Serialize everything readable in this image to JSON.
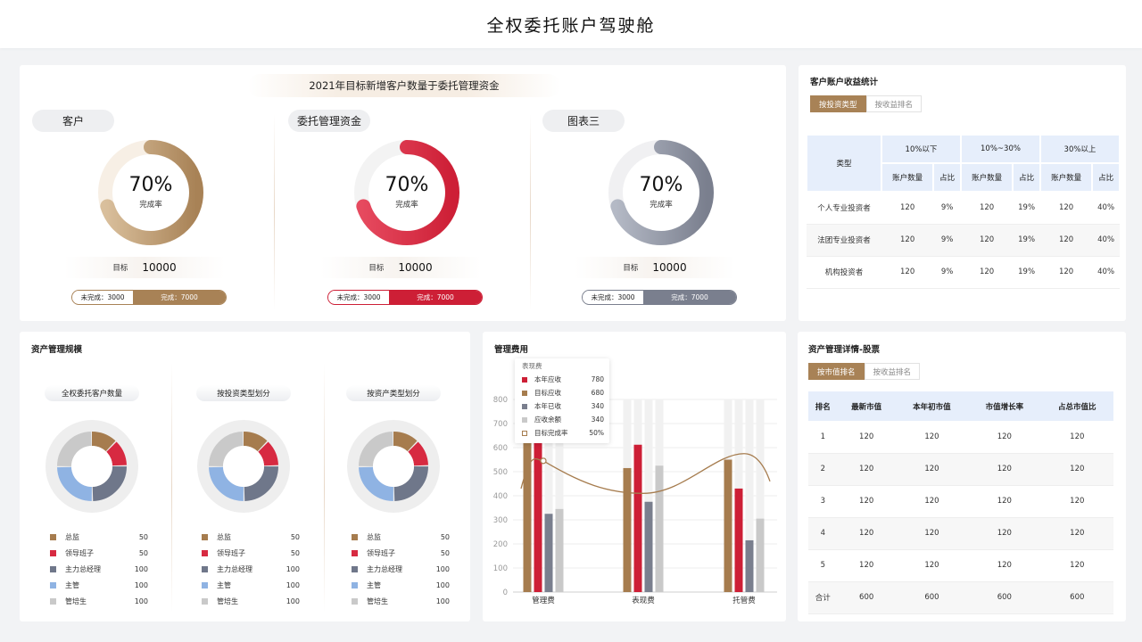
{
  "page_title": "全权委托账户驾驶舱",
  "goal": {
    "banner": "2021年目标新增客户数量于委托管理资金",
    "blocks": [
      {
        "label": "客户",
        "percent": "70%",
        "rate_label": "完成率",
        "target_label": "目标",
        "target_value": "10000",
        "undone": "未完成：3000",
        "done": "完成：7000",
        "fraction": 0.7,
        "color": "#a88256",
        "color_light": "#d9bf9c"
      },
      {
        "label": "委托管理资金",
        "percent": "70%",
        "rate_label": "完成率",
        "target_label": "目标",
        "target_value": "10000",
        "undone": "未完成：3000",
        "done": "完成：7000",
        "fraction": 0.7,
        "color": "#cd1f36",
        "color_light": "#e64a5f"
      },
      {
        "label": "图表三",
        "percent": "70%",
        "rate_label": "完成率",
        "target_label": "目标",
        "target_value": "10000",
        "undone": "未完成：3000",
        "done": "完成：7000",
        "fraction": 0.7,
        "color": "#7a7f8e",
        "color_light": "#b4b9c5"
      }
    ]
  },
  "income": {
    "title": "客户账户收益统计",
    "tabs": [
      "按投资类型",
      "按收益排名"
    ],
    "col_type": "类型",
    "groups": [
      "10%以下",
      "10%~30%",
      "30%以上"
    ],
    "sub_cols": [
      "账户数量",
      "占比"
    ],
    "rows": [
      [
        "个人专业投资者",
        "120",
        "9%",
        "120",
        "19%",
        "120",
        "40%"
      ],
      [
        "法团专业投资者",
        "120",
        "9%",
        "120",
        "19%",
        "120",
        "40%"
      ],
      [
        "机构投资者",
        "120",
        "9%",
        "120",
        "19%",
        "120",
        "40%"
      ]
    ]
  },
  "scale": {
    "title": "资产管理规模",
    "groups": [
      {
        "title": "全权委托客户数量"
      },
      {
        "title": "按投资类型划分"
      },
      {
        "title": "按资产类型划分"
      }
    ],
    "legend": [
      {
        "name": "总监",
        "value": "50",
        "color": "#a67c4e"
      },
      {
        "name": "领导班子",
        "value": "50",
        "color": "#d72a41"
      },
      {
        "name": "主力总经理",
        "value": "100",
        "color": "#6f778a"
      },
      {
        "name": "主管",
        "value": "100",
        "color": "#8fb3e3"
      },
      {
        "name": "管培生",
        "value": "100",
        "color": "#c9c9c9"
      }
    ]
  },
  "fees": {
    "title": "管理费用",
    "tooltip_title": "表现费",
    "tooltip": [
      {
        "name": "本年应收",
        "value": "780",
        "color": "#cd1f36",
        "hollow": false
      },
      {
        "name": "目标应收",
        "value": "680",
        "color": "#a67c4e",
        "hollow": false
      },
      {
        "name": "本年已收",
        "value": "340",
        "color": "#7a7f8e",
        "hollow": false
      },
      {
        "name": "应收余额",
        "value": "340",
        "color": "#c9c9c9",
        "hollow": false
      },
      {
        "name": "目标完成率",
        "value": "50%",
        "color": "#a67c4e",
        "hollow": true
      }
    ]
  },
  "chart_data": {
    "type": "bar",
    "categories": [
      "管理费",
      "表现费",
      "托管费"
    ],
    "ylim": [
      0,
      800
    ],
    "yticks": [
      "0",
      "100",
      "200",
      "300",
      "400",
      "500",
      "600",
      "700",
      "800"
    ],
    "series": [
      {
        "values": [
          680,
          515,
          550
        ],
        "color": "#a67c4e"
      },
      {
        "values": [
          780,
          612,
          430
        ],
        "color": "#cd1f36"
      },
      {
        "values": [
          325,
          375,
          215
        ],
        "color": "#7a7f8e"
      },
      {
        "values": [
          345,
          525,
          305
        ],
        "color": "#c9c9c9"
      }
    ],
    "line": {
      "values": [
        545,
        410,
        575
      ],
      "color": "#a67c4e"
    },
    "background_max": 800,
    "grid": true
  },
  "stock": {
    "title": "资产管理详情-股票",
    "tabs": [
      "按市值排名",
      "按收益排名"
    ],
    "columns": [
      "排名",
      "最新市值",
      "本年初市值",
      "市值增长率",
      "占总市值比"
    ],
    "rows": [
      [
        "1",
        "120",
        "120",
        "120",
        "120"
      ],
      [
        "2",
        "120",
        "120",
        "120",
        "120"
      ],
      [
        "3",
        "120",
        "120",
        "120",
        "120"
      ],
      [
        "4",
        "120",
        "120",
        "120",
        "120"
      ],
      [
        "5",
        "120",
        "120",
        "120",
        "120"
      ],
      [
        "合计",
        "600",
        "600",
        "600",
        "600"
      ]
    ]
  }
}
